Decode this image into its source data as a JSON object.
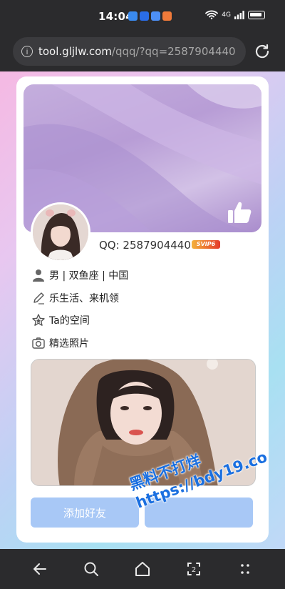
{
  "status_bar": {
    "time": "14:04",
    "network_label": "4G"
  },
  "browser": {
    "url_host": "tool.gljlw.com",
    "url_path": "/qqq/?qq=2587904440"
  },
  "profile": {
    "qq_text": "QQ: 2587904440",
    "vip_badge": "SVIP6",
    "basic_info": "男 | 双鱼座 | 中国",
    "signature": "乐生活、来机领",
    "space_link": "Ta的空间",
    "photos_label": "精选照片"
  },
  "actions": {
    "add_friend": "添加好友",
    "second_button": ""
  },
  "watermark": {
    "line1": "黑料不打烊",
    "line2": "https://bdy19.co"
  },
  "icons": {
    "info": "info-icon",
    "reload": "reload-icon",
    "like": "thumbs-up-icon",
    "user": "user-icon",
    "pen": "pen-icon",
    "star": "star-icon",
    "camera": "camera-icon",
    "nav": [
      "back-icon",
      "search-icon",
      "home-icon",
      "tabs-icon",
      "more-icon"
    ]
  },
  "colors": {
    "button": "#a8c8f6",
    "watermark": "#1a6fe0",
    "chrome": "#2b2b2d"
  }
}
